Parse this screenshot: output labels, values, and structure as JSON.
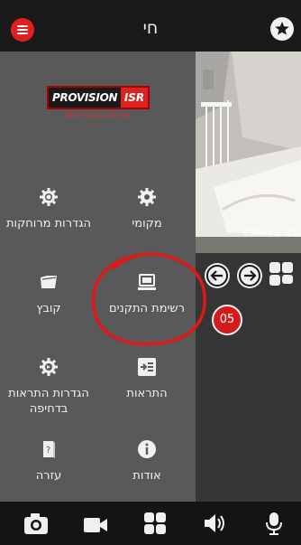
{
  "header": {
    "title": "חי",
    "menu_icon": "hamburger-icon",
    "favorite_icon": "star-icon"
  },
  "logo": {
    "brand": "PROVISION",
    "mark": "ISR",
    "tagline": "More you can see"
  },
  "menu": {
    "local": "מקומי",
    "remote_settings": "הגדרות מרוחקות",
    "device_list": "רשימת התקנים",
    "file": "קובץ",
    "alerts": "התראות",
    "push_alert_settings": "הגדרות התראות בדחיפה",
    "about": "אודות",
    "help": "עזרה"
  },
  "video": {
    "camera_label": "Camera 01"
  },
  "annotation": {
    "badge": "05",
    "color": "#e01818"
  },
  "colors": {
    "accent": "#e02020",
    "panel": "#595959",
    "topbar": "#1a1a1a"
  },
  "bottom_bar": [
    "camera-icon",
    "video-record-icon",
    "grid-view-icon",
    "speaker-icon",
    "microphone-icon"
  ]
}
